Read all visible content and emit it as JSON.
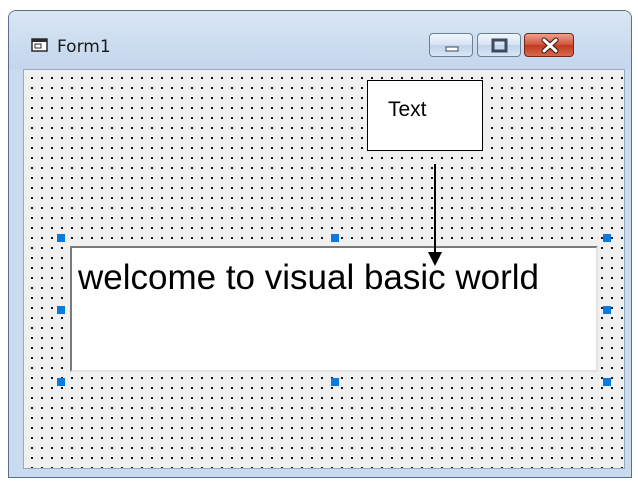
{
  "window": {
    "title": "Form1",
    "icon": "form-icon",
    "controls": [
      "minimize-icon",
      "maximize-icon",
      "close-icon"
    ]
  },
  "textbox": {
    "value": "welcome to visual basic world"
  },
  "annotation": {
    "label": "Text"
  },
  "colors": {
    "selection_handle": "#0a7bdc",
    "close_button": "#c9452b",
    "form_background": "#f0f0f0"
  }
}
